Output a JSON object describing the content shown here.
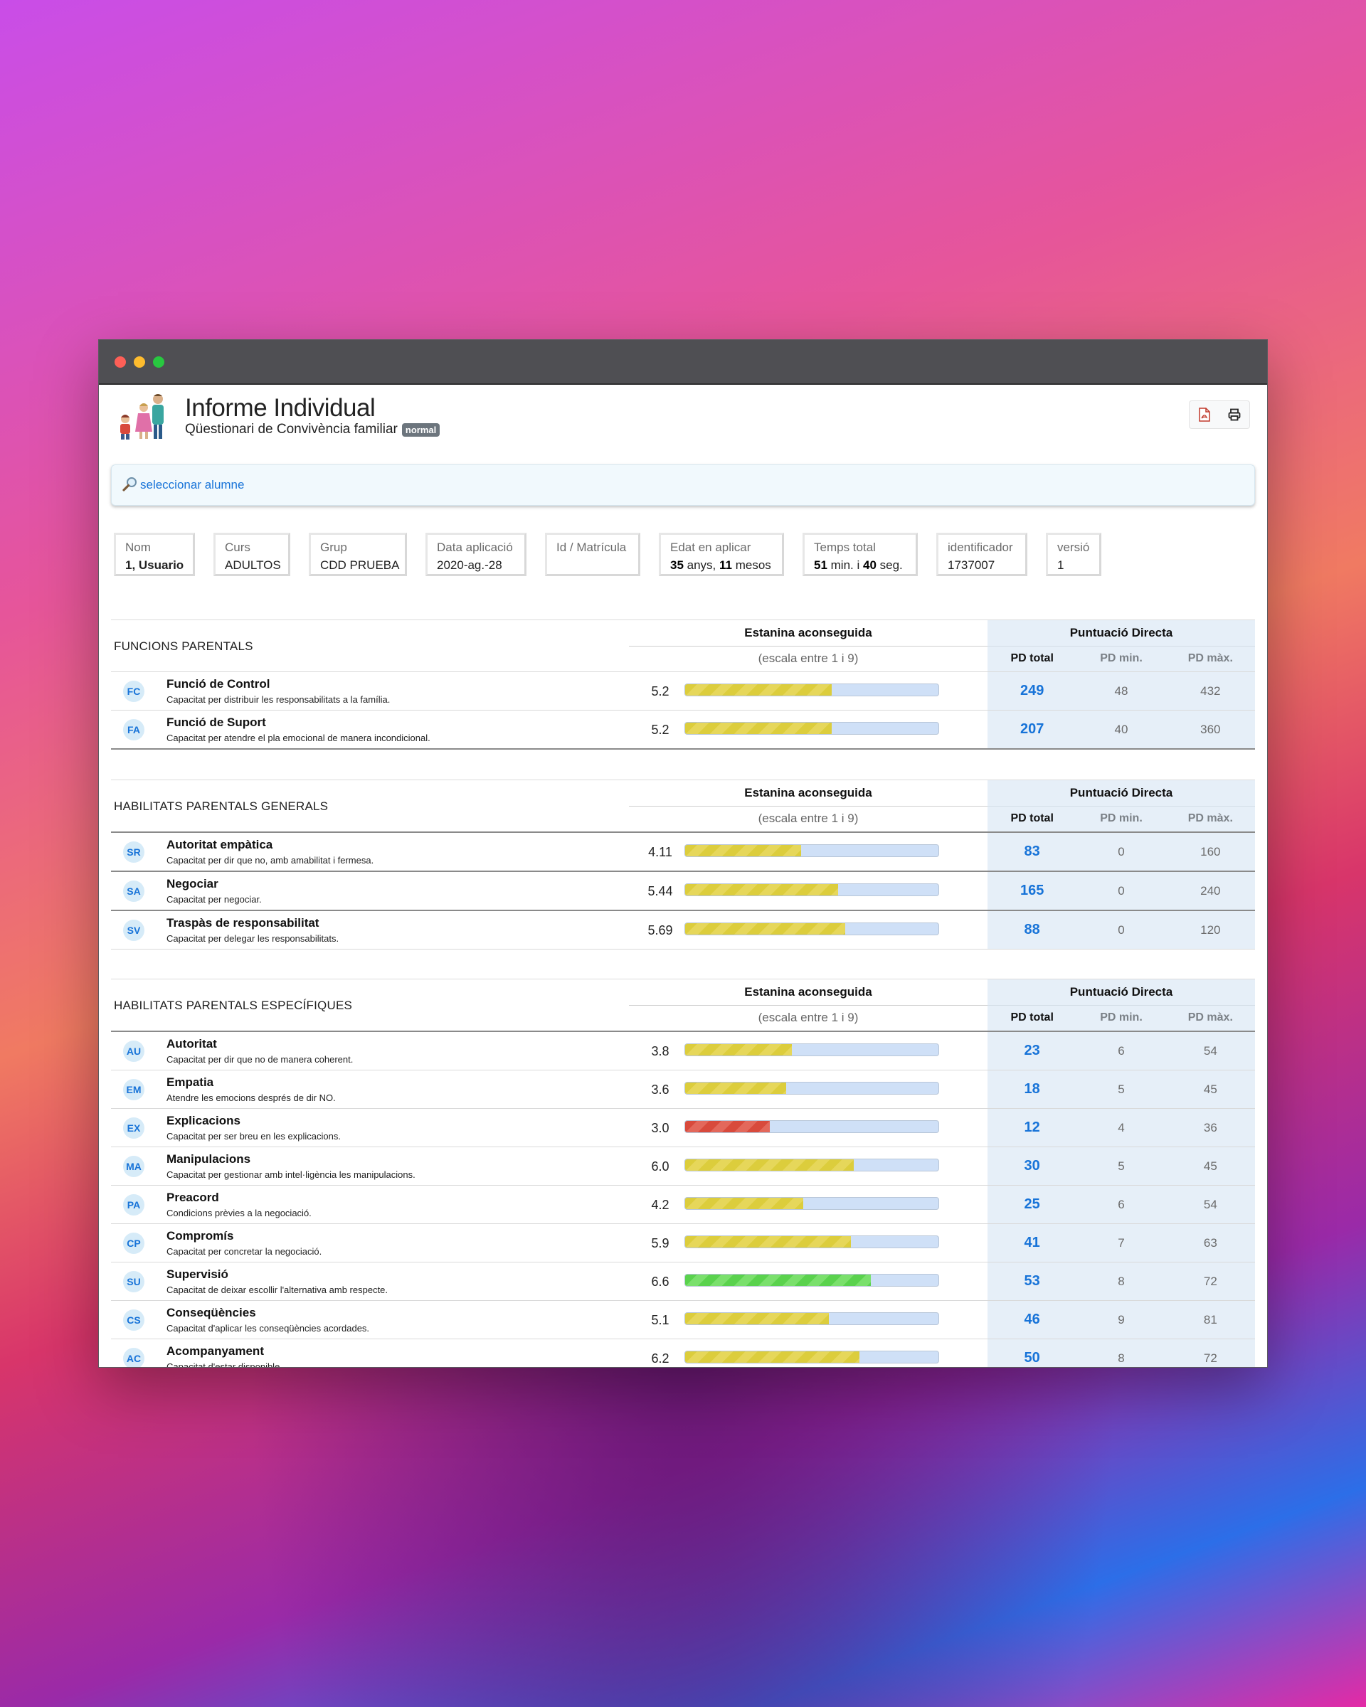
{
  "report": {
    "title": "Informe Individual",
    "subtitle": "Qüestionari de Convivència familiar",
    "badge": "normal"
  },
  "toolbar": {
    "pdf_icon": "pdf-icon",
    "print_icon": "printer-icon"
  },
  "search": {
    "link": "seleccionar alumne",
    "icon": "magnifier-icon"
  },
  "info": [
    {
      "label": "Nom",
      "value": "1, Usuario",
      "bold": true
    },
    {
      "label": "Curs",
      "value": "ADULTOS"
    },
    {
      "label": "Grup",
      "value": "CDD PRUEBA"
    },
    {
      "label": "Data aplicació",
      "value": "2020-ag.-28"
    },
    {
      "label": "Id / Matrícula",
      "value": ""
    },
    {
      "label": "Edat en aplicar",
      "value_parts": [
        "35",
        " anys, ",
        "11",
        " mesos"
      ]
    },
    {
      "label": "Temps total",
      "value_parts": [
        "51",
        " min. i ",
        "40",
        " seg."
      ]
    },
    {
      "label": "identificador",
      "value": "1737007"
    },
    {
      "label": "versió",
      "value": "1"
    }
  ],
  "columns": {
    "estanina": "Estanina aconseguida",
    "scale": "(escala entre 1 i 9)",
    "pd": "Puntuació Directa",
    "pd_total": "PD total",
    "pd_min": "PD min.",
    "pd_max": "PD màx."
  },
  "sections": [
    {
      "title": "FUNCIONS PARENTALS",
      "rows": [
        {
          "abbr": "FC",
          "name": "Funció de Control",
          "desc": "Capacitat per distribuir les responsabilitats a la família.",
          "value": "5.2",
          "fill": 5.2,
          "color": "yellow",
          "pd_total": "249",
          "pd_min": "48",
          "pd_max": "432"
        },
        {
          "abbr": "FA",
          "name": "Funció de Suport",
          "desc": "Capacitat per atendre el pla emocional de manera incondicional.",
          "value": "5.2",
          "fill": 5.2,
          "color": "yellow",
          "pd_total": "207",
          "pd_min": "40",
          "pd_max": "360"
        }
      ]
    },
    {
      "title": "HABILITATS PARENTALS GENERALS",
      "rows": [
        {
          "abbr": "SR",
          "name": "Autoritat empàtica",
          "desc": "Capacitat per dir que no, amb amabilitat i fermesa.",
          "value": "4.11",
          "fill": 4.11,
          "color": "yellow",
          "pd_total": "83",
          "pd_min": "0",
          "pd_max": "160"
        },
        {
          "abbr": "SA",
          "name": "Negociar",
          "desc": "Capacitat per negociar.",
          "value": "5.44",
          "fill": 5.44,
          "color": "yellow",
          "pd_total": "165",
          "pd_min": "0",
          "pd_max": "240"
        },
        {
          "abbr": "SV",
          "name": "Traspàs de responsabilitat",
          "desc": "Capacitat per delegar les responsabilitats.",
          "value": "5.69",
          "fill": 5.69,
          "color": "yellow",
          "pd_total": "88",
          "pd_min": "0",
          "pd_max": "120"
        }
      ]
    },
    {
      "title": "HABILITATS PARENTALS ESPECÍFIQUES",
      "rows": [
        {
          "abbr": "AU",
          "name": "Autoritat",
          "desc": "Capacitat per dir que no de manera coherent.",
          "value": "3.8",
          "fill": 3.8,
          "color": "yellow",
          "pd_total": "23",
          "pd_min": "6",
          "pd_max": "54"
        },
        {
          "abbr": "EM",
          "name": "Empatia",
          "desc": "Atendre les emocions després de dir NO.",
          "value": "3.6",
          "fill": 3.6,
          "color": "yellow",
          "pd_total": "18",
          "pd_min": "5",
          "pd_max": "45"
        },
        {
          "abbr": "EX",
          "name": "Explicacions",
          "desc": "Capacitat per ser breu en les explicacions.",
          "value": "3.0",
          "fill": 3.0,
          "color": "red",
          "pd_total": "12",
          "pd_min": "4",
          "pd_max": "36"
        },
        {
          "abbr": "MA",
          "name": "Manipulacions",
          "desc": "Capacitat per gestionar amb intel·ligència les manipulacions.",
          "value": "6.0",
          "fill": 6.0,
          "color": "yellow",
          "pd_total": "30",
          "pd_min": "5",
          "pd_max": "45"
        },
        {
          "abbr": "PA",
          "name": "Preacord",
          "desc": "Condicions prèvies a la negociació.",
          "value": "4.2",
          "fill": 4.2,
          "color": "yellow",
          "pd_total": "25",
          "pd_min": "6",
          "pd_max": "54"
        },
        {
          "abbr": "CP",
          "name": "Compromís",
          "desc": "Capacitat per concretar la negociació.",
          "value": "5.9",
          "fill": 5.9,
          "color": "yellow",
          "pd_total": "41",
          "pd_min": "7",
          "pd_max": "63"
        },
        {
          "abbr": "SU",
          "name": "Supervisió",
          "desc": "Capacitat de deixar escollir l'alternativa amb respecte.",
          "value": "6.6",
          "fill": 6.6,
          "color": "green",
          "pd_total": "53",
          "pd_min": "8",
          "pd_max": "72"
        },
        {
          "abbr": "CS",
          "name": "Conseqüències",
          "desc": "Capacitat d'aplicar les conseqüències acordades.",
          "value": "5.1",
          "fill": 5.1,
          "color": "yellow",
          "pd_total": "46",
          "pd_min": "9",
          "pd_max": "81"
        },
        {
          "abbr": "AC",
          "name": "Acompanyament",
          "desc": "Capacitat d'estar disponible.",
          "value": "6.2",
          "fill": 6.2,
          "color": "yellow",
          "pd_total": "50",
          "pd_min": "8",
          "pd_max": "72"
        }
      ]
    }
  ],
  "colors": {
    "link": "#1773d8",
    "pd_bg": "#e6eff8",
    "bar_bg": "#cfe0f7"
  }
}
